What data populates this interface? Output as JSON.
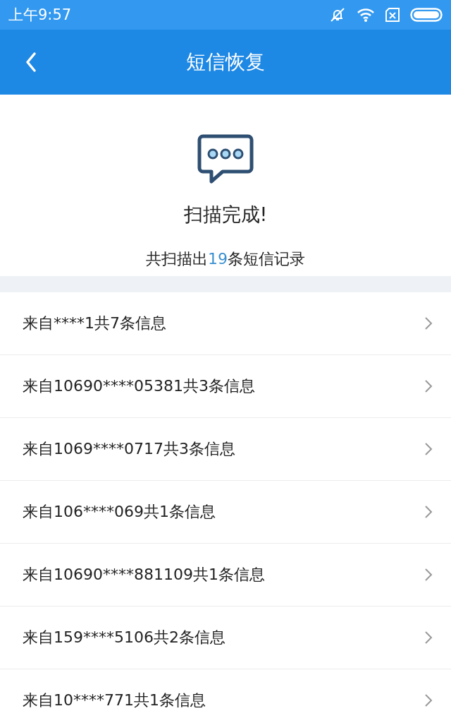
{
  "status_bar": {
    "time": "上午9:57"
  },
  "header": {
    "title": "短信恢复"
  },
  "scan": {
    "title": "扫描完成!",
    "summary": {
      "prefix": "共扫描出",
      "count": "19",
      "suffix": "条短信记录"
    }
  },
  "conversations": [
    {
      "label": "来自****1共7条信息"
    },
    {
      "label": "来自10690****05381共3条信息"
    },
    {
      "label": "来自1069****0717共3条信息"
    },
    {
      "label": "来自106****069共1条信息"
    },
    {
      "label": "来自10690****881109共1条信息"
    },
    {
      "label": "来自159****5106共2条信息"
    },
    {
      "label": "来自10****771共1条信息"
    }
  ]
}
